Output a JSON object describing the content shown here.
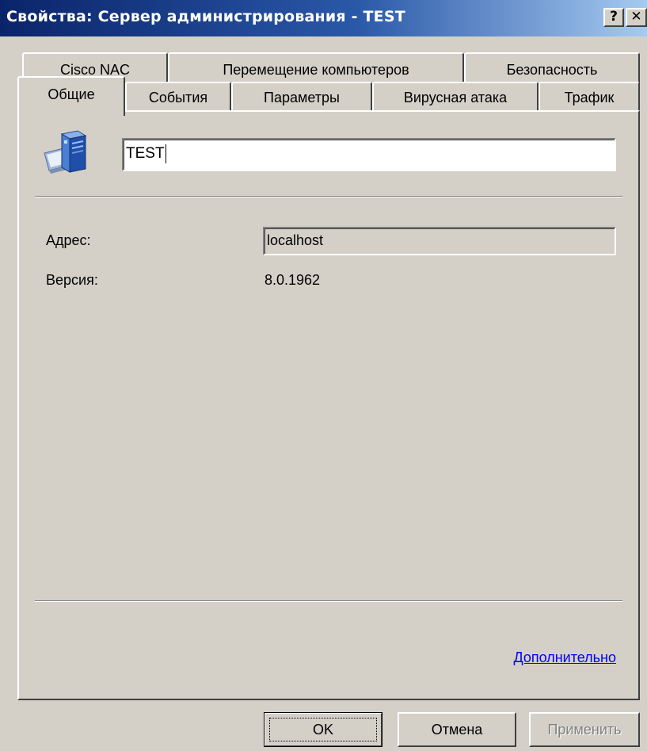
{
  "window": {
    "title": "Свойства: Сервер администрирования - TEST",
    "help_label": "?",
    "close_label": "✕"
  },
  "tabs": {
    "row1": [
      "Cisco NAC",
      "Перемещение компьютеров",
      "Безопасность"
    ],
    "row2": [
      "Общие",
      "События",
      "Параметры",
      "Вирусная атака",
      "Трафик"
    ],
    "active": "Общие"
  },
  "general": {
    "icon": "server-icon",
    "name_value": "TEST",
    "address_label": "Адрес:",
    "address_value": "localhost",
    "version_label": "Версия:",
    "version_value": "8.0.1962",
    "more_link": "Дополнительно"
  },
  "buttons": {
    "ok": "OK",
    "cancel": "Отмена",
    "apply": "Применить"
  },
  "colors": {
    "face": "#d4d0c8",
    "title_start": "#0a246a",
    "title_end": "#a6caf0",
    "link": "#0000ff"
  }
}
